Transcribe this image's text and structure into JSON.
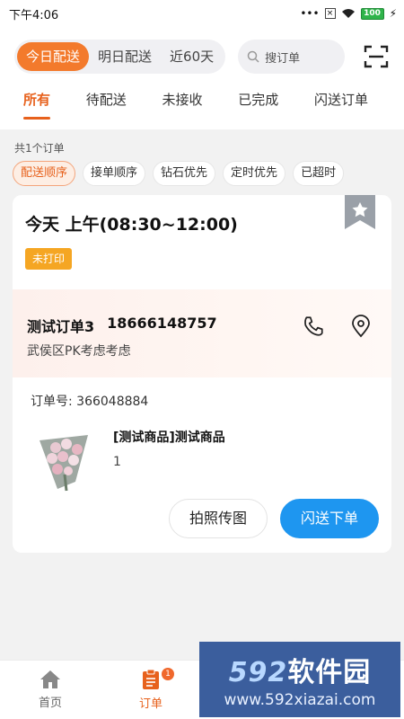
{
  "status_bar": {
    "time": "下午4:06",
    "battery": "100"
  },
  "header": {
    "date_tabs": [
      {
        "label": "今日配送",
        "active": true
      },
      {
        "label": "明日配送",
        "active": false
      },
      {
        "label": "近60天",
        "active": false
      }
    ],
    "search": {
      "placeholder": "搜订单"
    }
  },
  "status_tabs": [
    {
      "label": "所有",
      "active": true
    },
    {
      "label": "待配送",
      "active": false
    },
    {
      "label": "未接收",
      "active": false
    },
    {
      "label": "已完成",
      "active": false
    },
    {
      "label": "闪送订单",
      "active": false
    }
  ],
  "summary": "共1个订单",
  "sort_filters": [
    {
      "label": "配送顺序",
      "active": true
    },
    {
      "label": "接单顺序",
      "active": false
    },
    {
      "label": "钻石优先",
      "active": false
    },
    {
      "label": "定时优先",
      "active": false
    },
    {
      "label": "已超时",
      "active": false
    }
  ],
  "order": {
    "delivery_time": "今天 上午(08:30~12:00)",
    "print_status": "未打印",
    "customer_name": "测试订单3",
    "customer_phone": "18666148757",
    "address": "武侯区PK考虑考虑",
    "order_number": "订单号: 366048884",
    "product_name": "[测试商品]测试商品",
    "product_qty": "1",
    "buttons": {
      "photo": "拍照传图",
      "flash_delivery": "闪送下单"
    }
  },
  "bottom_nav": [
    {
      "label": "首页",
      "icon": "home-icon",
      "active": false
    },
    {
      "label": "订单",
      "icon": "orders-icon",
      "active": true,
      "badge": "1"
    }
  ],
  "watermark": {
    "brand_digits": "592",
    "brand_text": "软件园",
    "url": "www.592xiazai.com"
  },
  "colors": {
    "accent": "#e7611c",
    "primary_button": "#1e96f0",
    "badge": "#f5a623"
  }
}
